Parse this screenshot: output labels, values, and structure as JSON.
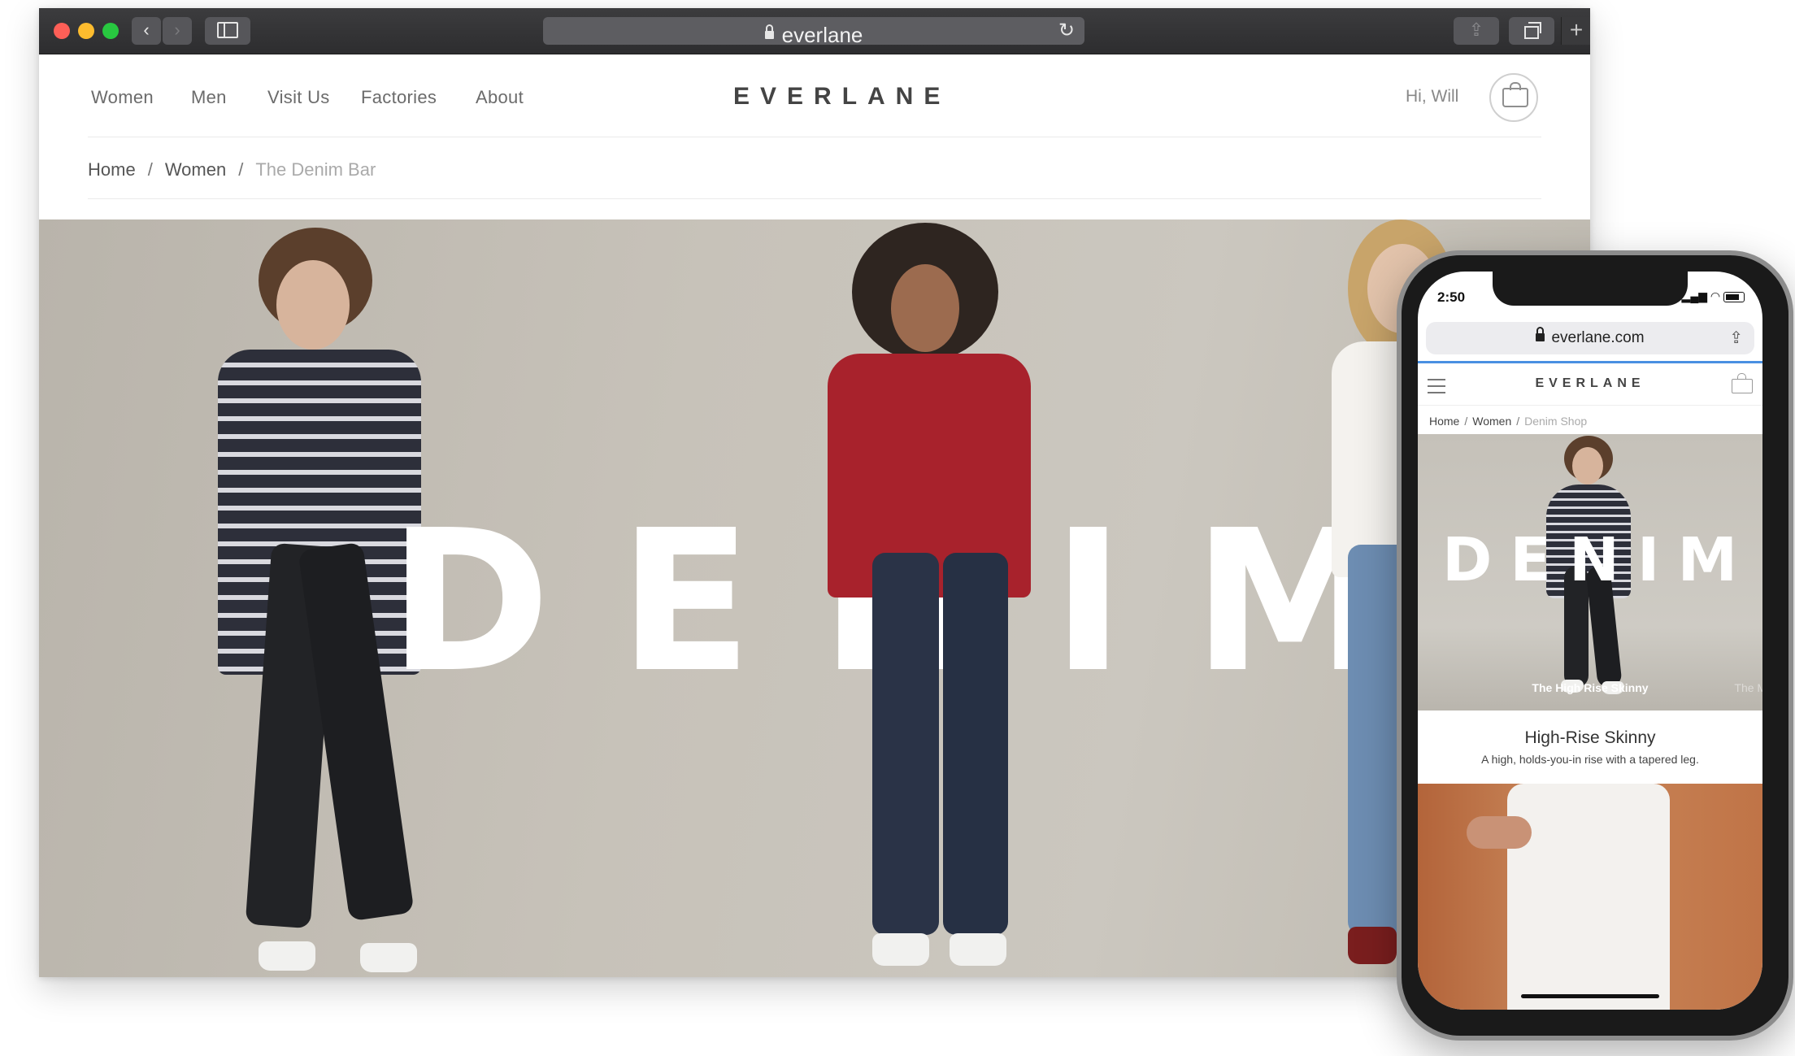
{
  "browser": {
    "url": "everlane",
    "toolbar": {
      "back_icon": "chevron-left-icon",
      "forward_icon": "chevron-right-icon",
      "sidebar_icon": "sidebar-icon",
      "share_icon": "share-icon",
      "tabs_icon": "tabs-overview-icon",
      "newtab_icon": "plus-icon",
      "reload_icon": "reload-icon"
    }
  },
  "site": {
    "nav": [
      "Women",
      "Men",
      "Visit Us",
      "Factories",
      "About"
    ],
    "logo": "EVERLANE",
    "greeting": "Hi, Will",
    "breadcrumb": {
      "home": "Home",
      "section": "Women",
      "current": "The Denim Bar",
      "separator": "/"
    },
    "hero": {
      "title": "DENIM"
    }
  },
  "phone": {
    "time": "2:50",
    "url": "everlane.com",
    "logo": "EVERLANE",
    "breadcrumb": {
      "home": "Home",
      "section": "Women",
      "current": "Denim Shop",
      "separator": "/"
    },
    "hero": {
      "title": "DENIM",
      "caption": "The High Rise Skinny",
      "next_caption": "The Mid R"
    },
    "product": {
      "title": "High-Rise Skinny",
      "description": "A high, holds-you-in rise with a tapered leg."
    }
  },
  "colors": {
    "hero_bg": "#c7c2b9",
    "titlebar": "#2d2d2f",
    "accent_progress": "#4a90e2"
  }
}
